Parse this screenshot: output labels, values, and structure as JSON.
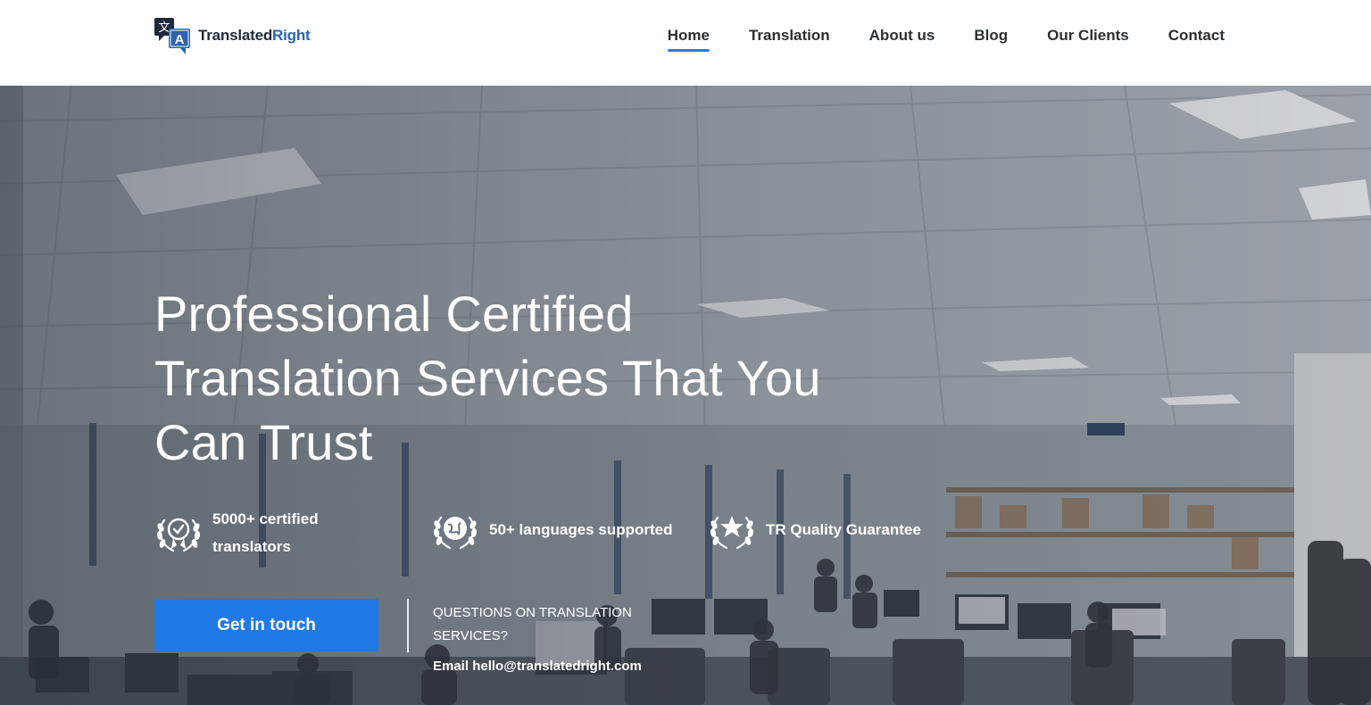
{
  "brand": {
    "name_part1": "Translated",
    "name_part2": "Right",
    "logo_glyph_top": "文",
    "logo_glyph_bottom": "A",
    "colors": {
      "dark": "#1e2a3a",
      "accent": "#2b63b0"
    }
  },
  "nav": {
    "items": [
      {
        "label": "Home",
        "active": true
      },
      {
        "label": "Translation",
        "active": false
      },
      {
        "label": "About us",
        "active": false
      },
      {
        "label": "Blog",
        "active": false
      },
      {
        "label": "Our Clients",
        "active": false
      },
      {
        "label": "Contact",
        "active": false
      }
    ],
    "active_underline_color": "#2b7be0"
  },
  "hero": {
    "headline_line1": "Professional Certified",
    "headline_line2": "Translation Services That You",
    "headline_line3": "Can Trust",
    "features": [
      {
        "icon": "laurel-check-badge-icon",
        "line1": "5000+ certified",
        "line2": "translators"
      },
      {
        "icon": "laurel-globe-icon",
        "line1": "50+ languages supported",
        "line2": ""
      },
      {
        "icon": "laurel-star-icon",
        "line1": "TR Quality Guarantee",
        "line2": ""
      }
    ],
    "cta_label": "Get in touch",
    "cta_color": "#1f7ae6",
    "questions_line1": "QUESTIONS ON TRANSLATION",
    "questions_line2": "SERVICES?",
    "email_label": "Email",
    "email_address": "hello@translatedright.com"
  }
}
